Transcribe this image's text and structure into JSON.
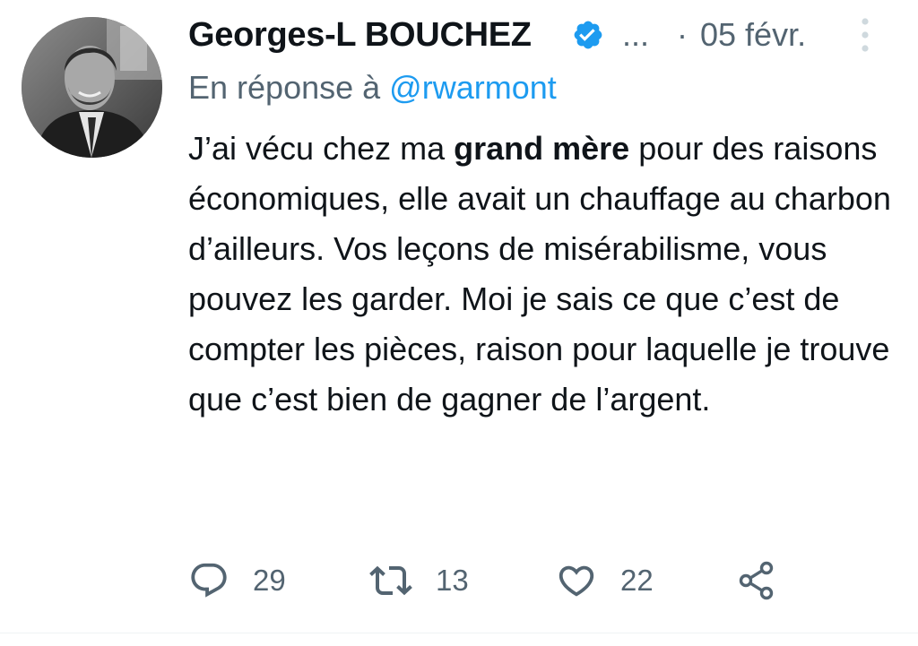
{
  "tweet": {
    "author_name": "Georges-L BOUCHEZ",
    "handle_truncated": "...",
    "separator": "·",
    "date": "05 févr.",
    "reply_prefix": "En réponse à",
    "reply_mention": "@rwarmont",
    "body_part1": "J’ai vécu chez ma ",
    "body_bold": "grand mère",
    "body_part2": " pour des raisons économiques, elle avait un chauffage au charbon d’ailleurs. Vos leçons de misérabilisme, vous pouvez les garder. Moi je sais ce que c’est de compter les pièces, raison pour laquelle je trouve que c’est bien de gagner de l’argent."
  },
  "actions": {
    "replies": "29",
    "retweets": "13",
    "likes": "22"
  },
  "icons": {
    "verified": "verified-badge-icon",
    "more": "more-options-icon",
    "reply": "reply-icon",
    "retweet": "retweet-icon",
    "like": "heart-icon",
    "share": "share-icon"
  },
  "colors": {
    "text": "#0f1419",
    "secondary": "#536471",
    "accent": "#1d9bf0"
  }
}
